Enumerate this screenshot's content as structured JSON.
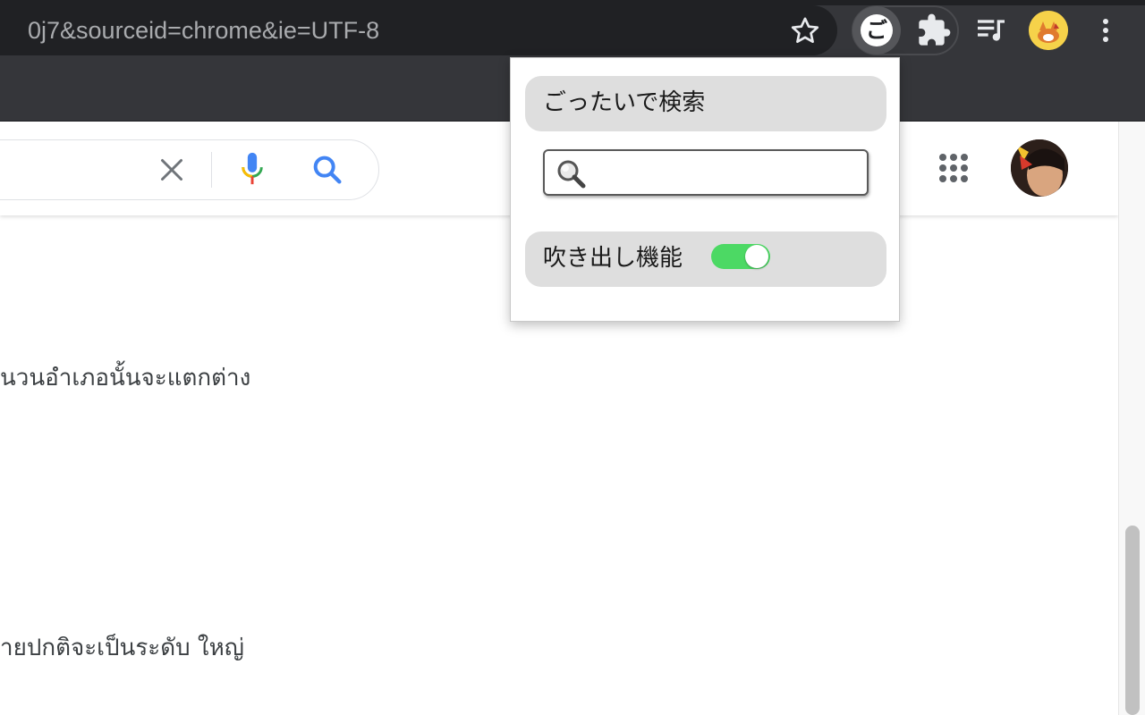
{
  "browser": {
    "url_visible": "0j7&sourceid=chrome&ie=UTF-8",
    "extension_icon_glyph": "ご",
    "icons": {
      "bookmark": "star-icon",
      "extension_active": "goattai-extension-icon",
      "extensions": "puzzle-icon",
      "media": "media-queue-icon",
      "profile": "profile-avatar",
      "menu": "more-vert-icon"
    }
  },
  "search": {
    "icons": {
      "clear": "close-icon",
      "voice": "mic-icon",
      "search": "search-icon",
      "apps": "apps-grid-icon",
      "account": "account-avatar"
    }
  },
  "results": [
    {
      "text": "นวนอำเภอนั้นจะแตกต่าง"
    },
    {
      "text": "ายปกติจะเป็นระดับ ใหญ่"
    }
  ],
  "popup": {
    "title": "ごったいで検索",
    "search": {
      "value": "",
      "placeholder": ""
    },
    "toggle_label": "吹き出し機能",
    "toggle_on": true
  },
  "colors": {
    "chrome_dark": "#35363a",
    "omnibox": "#202124",
    "toggle_on": "#4cd964",
    "popup_row_bg": "#dedede",
    "google_blue": "#4285f4",
    "google_red": "#ea4335",
    "google_yellow": "#fbbc04",
    "google_green": "#34a853"
  }
}
